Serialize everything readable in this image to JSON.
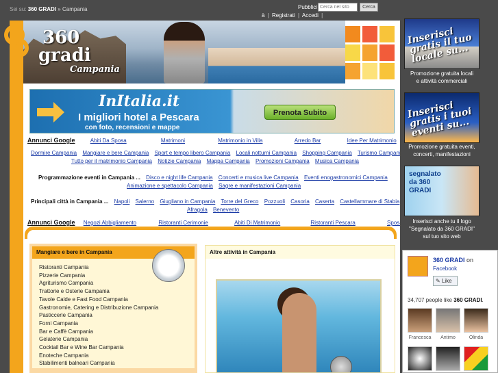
{
  "breadcrumb": {
    "prefix": "Sei su:",
    "site": "360 GRADI",
    "sep": "»",
    "current": "Campania"
  },
  "search": {
    "label": "Pubblici",
    "placeholder": "Cerca nel sito",
    "button": "Cerca"
  },
  "account": {
    "pre": "à",
    "register": "Registrati",
    "login": "Accedi",
    "post": "|"
  },
  "logo": {
    "num": "360",
    "gradi": "gradi",
    "region": "Campania"
  },
  "banner": {
    "brand": "InItalia.it",
    "line1": "I migliori hotel a Pescara",
    "line2": "con foto, recensioni e mappe",
    "cta": "Prenota Subito"
  },
  "annunci_label": "Annunci Google",
  "ads_top": [
    "Abiti Da Sposa",
    "Matrimoni",
    "Matrimonio in Villa",
    "Arredo Bar",
    "Idee Per Matrimonio"
  ],
  "categories_1": [
    "Dormire Campania",
    "Mangiare e bere Campania",
    "Sport e tempo libero Campania",
    "Locali notturni Campania",
    "Shopping Campania",
    "Turismo Campania"
  ],
  "categories_2": [
    "Tutto per il matrimonio Campania",
    "Notizie Campania",
    "Mappa Campania",
    "Promozioni Campania",
    "Musica Campania"
  ],
  "eventi": {
    "label": "Programmazione eventi in Campania ...",
    "row1": [
      "Disco e night life Campania",
      "Concerti e musica live Campania",
      "Eventi enogastronomici Campania"
    ],
    "row2": [
      "Animazione e spettacolo Campania",
      "Sagre e manifestazioni Campania"
    ]
  },
  "citta": {
    "label": "Principali città in Campania ...",
    "row1": [
      "Napoli",
      "Salerno",
      "Giugliano in Campania",
      "Torre del Greco",
      "Pozzuoli",
      "Casoria",
      "Caserta",
      "Castellammare di Stabia"
    ],
    "row2": [
      "Afragola",
      "Benevento"
    ]
  },
  "ads_bottom": [
    "Negozi Abbigliamento",
    "Ristoranti Cerimonie",
    "Abiti Di Matrimonio",
    "Ristoranti Pescara",
    "Sposa Civile"
  ],
  "mangiare": {
    "title": "Mangiare e bere in Campania",
    "items": [
      "Ristoranti Campania",
      "Pizzerie Campania",
      "Agriturismo Campania",
      "Trattorie e Osterie Campania",
      "Tavole Calde e Fast Food Campania",
      "Gastronomie, Catering e Distribuzione Campania",
      "Pasticcerie Campania",
      "Forni Campania",
      "Bar e Caffè Campania",
      "Gelaterie Campania",
      "Cocktail Bar e Wine Bar Campania",
      "Enoteche Campania",
      "Stabilimenti balneari Campania"
    ]
  },
  "altre": {
    "title": "Altre attività in Campania"
  },
  "sidebar": {
    "promo1": {
      "cap": "Inserisci gratis il tuo locale su...",
      "text1": "Promozione gratuita locali",
      "text2": "e attività commerciali"
    },
    "promo2": {
      "cap": "Inserisci gratis i tuoi eventi su...",
      "text1": "Promozione gratuita eventi,",
      "text2": "concerti, manifestazioni"
    },
    "promo3": {
      "cap": "segnalato da 360 GRADI",
      "text1": "Inserisci anche tu il logo",
      "text2": "\"Segnalato da 360 GRADI\"",
      "text3": "sul tuo sito web"
    }
  },
  "facebook": {
    "name": "360 GRADI",
    "on": "on",
    "network": "Facebook",
    "like": "Like",
    "count": "34,707 people like",
    "count_name": "360 GRADI",
    "count_end": ".",
    "friends": [
      "Francesca",
      "Antimo",
      "Olinda"
    ]
  },
  "colors": {
    "accent": "#f3a51c",
    "link": "#1a3aa6",
    "bg": "#4a4a4a"
  }
}
